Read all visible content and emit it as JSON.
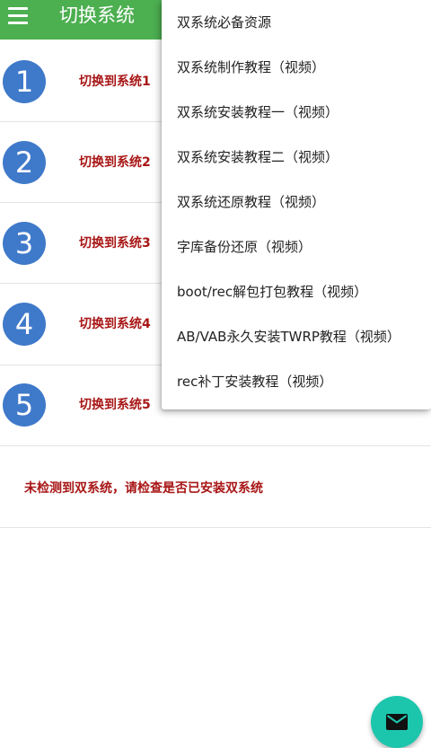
{
  "app_bar": {
    "title": "切换系统",
    "menu_icon": "hamburger-menu-icon",
    "color": "#4caf50"
  },
  "systems": [
    {
      "number": "1",
      "label": "切换到系统1"
    },
    {
      "number": "2",
      "label": "切换到系统2"
    },
    {
      "number": "3",
      "label": "切换到系统3"
    },
    {
      "number": "4",
      "label": "切换到系统4"
    },
    {
      "number": "5",
      "label": "切换到系统5"
    }
  ],
  "warning": "未检测到双系统，请检查是否已安装双系统",
  "dropdown_menu": {
    "items": [
      "双系统必备资源",
      "双系统制作教程（视频）",
      "双系统安装教程一（视频）",
      "双系统安装教程二（视频）",
      "双系统还原教程（视频）",
      "字库备份还原（视频）",
      "boot/rec解包打包教程（视频）",
      "AB/VAB永久安装TWRP教程（视频）",
      "rec补丁安装教程（视频）"
    ]
  },
  "fab": {
    "icon": "mail-icon",
    "color": "#1cc6ad"
  },
  "colors": {
    "number_circle": "#3f79c9",
    "label_red": "#a81616"
  }
}
